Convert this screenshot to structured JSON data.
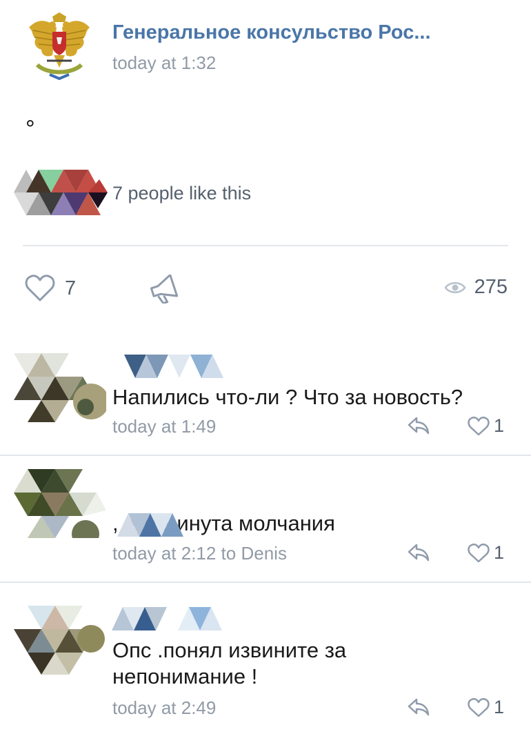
{
  "post": {
    "author": "Генеральное консульство Рос...",
    "time": "today at 1:32",
    "text": "°",
    "likes_summary": "7 people like this",
    "like_count": "7",
    "views": "275"
  },
  "icons": {
    "post_avatar": "coat-of-arms-icon",
    "like": "heart-icon",
    "share": "megaphone-icon",
    "views": "eye-icon",
    "reply": "reply-arrow-icon"
  },
  "colors": {
    "author": "#4a76a8",
    "meta": "#919aa6",
    "icon": "#8f9bab",
    "divider": "#e3e6ea"
  },
  "comments": [
    {
      "text": "Напились что-ли ? Что за новость?",
      "time": "today at 1:49",
      "like_count": "1"
    },
    {
      "text": ", это минута молчания",
      "time": "today at 2:12 to Denis",
      "like_count": "1"
    },
    {
      "text": "Опс .понял извините за\nнепонимание !",
      "time": "today at 2:49",
      "like_count": "1"
    }
  ]
}
